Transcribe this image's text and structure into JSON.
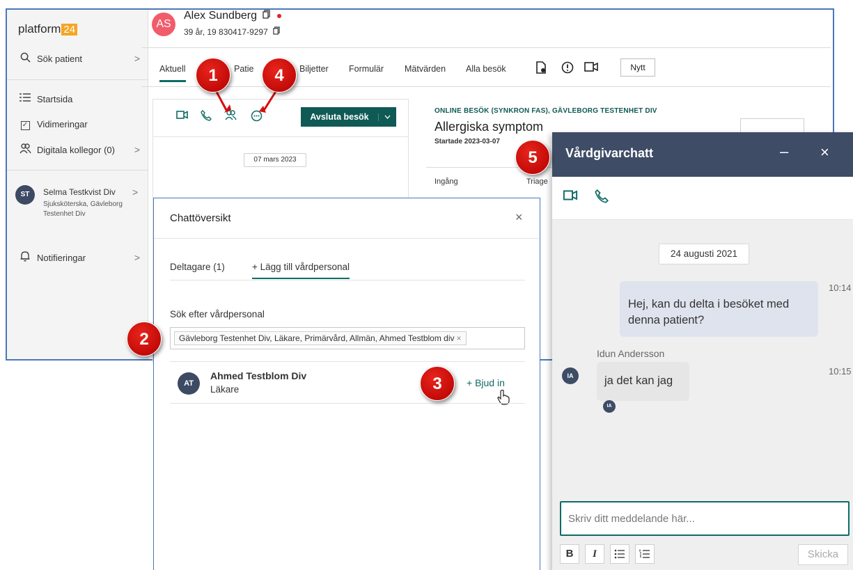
{
  "sidebar": {
    "logo_text": "platform",
    "logo_badge": "24",
    "items": [
      {
        "label": "Sök patient",
        "icon": "search-icon"
      },
      {
        "label": "Startsida",
        "icon": "list-icon"
      },
      {
        "label": "Vidimeringar",
        "icon": "checkbox-icon"
      },
      {
        "label": "Digitala kollegor (0)",
        "icon": "people-icon"
      }
    ],
    "user": {
      "initials": "ST",
      "name": "Selma Testkvist Div",
      "role": "Sjuksköterska, Gävleborg Testenhet Div"
    },
    "notifications": "Notifieringar",
    "chevron": ">"
  },
  "patient": {
    "initials": "AS",
    "name": "Alex Sundberg",
    "details": "39 år, 19 830417-9297"
  },
  "tabs": [
    "Aktuell",
    "Patie",
    "Biljetter",
    "Formulär",
    "Mätvärden",
    "Alla besök"
  ],
  "tab_new": "Nytt",
  "toolbar": {
    "end_visit": "Avsluta besök",
    "date": "07 mars 2023"
  },
  "visit": {
    "type": "ONLINE BESÖK (SYNKRON FAS), GÄVLEBORG TESTENHET DIV",
    "title": "Allergiska symptom",
    "started": "Startade 2023-03-07",
    "ingang": "Ingång",
    "triage": "Triage"
  },
  "modal": {
    "title": "Chattöversikt",
    "close": "×",
    "tab_participants": "Deltagare (1)",
    "tab_add": "+ Lägg till vårdpersonal",
    "search_label": "Sök efter vårdpersonal",
    "chip": "Gävleborg Testenhet Div, Läkare, Primärvård, Allmän, Ahmed Testblom div",
    "chip_remove": "×",
    "result": {
      "initials": "AT",
      "name": "Ahmed Testblom Div",
      "role": "Läkare",
      "action": "+ Bjud in"
    }
  },
  "vchat": {
    "title": "Vårdgivarchatt",
    "minimize": "–",
    "close": "×",
    "date": "24 augusti 2021",
    "messages": [
      {
        "text": "Hej, kan du delta i besöket med denna patient?",
        "time": "10:14"
      },
      {
        "sender": "Idun Andersson",
        "initials": "IA",
        "text": "ja det kan jag",
        "time": "10:15"
      }
    ],
    "input_placeholder": "Skriv ditt meddelande här...",
    "format_bold": "B",
    "format_italic": "I",
    "send": "Skicka"
  },
  "annotations": [
    "1",
    "2",
    "3",
    "4",
    "5"
  ],
  "colors": {
    "accent": "#0f6b66",
    "badge": "#d40f0f",
    "chat_header": "#3e4c66",
    "frame": "#4a78b8"
  }
}
